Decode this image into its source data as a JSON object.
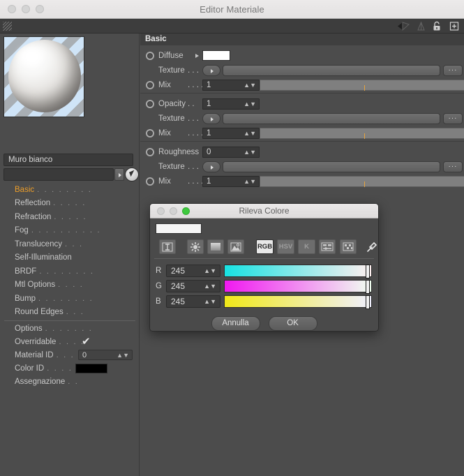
{
  "window": {
    "title": "Editor Materiale",
    "traffic_lights": [
      "close",
      "minimize",
      "zoom"
    ],
    "toolbar_icons": [
      "camera-icon",
      "light-icon",
      "lock-icon",
      "add-icon"
    ]
  },
  "material": {
    "preview_name": "material-preview-sphere",
    "name_value": "Muro bianco",
    "search_value": "",
    "picker_icon": "arrow-picker-icon"
  },
  "channels": [
    {
      "label": "Basic",
      "dots": ". . . . . . . ."
    },
    {
      "label": "Reflection",
      "dots": ". . . . ."
    },
    {
      "label": "Refraction",
      "dots": ". . . . ."
    },
    {
      "label": "Fog",
      "dots": ". . . . . . . . . ."
    },
    {
      "label": "Translucency",
      "dots": ". . ."
    },
    {
      "label": "Self-Illumination",
      "dots": ""
    },
    {
      "label": "BRDF",
      "dots": ". . . . . . . ."
    },
    {
      "label": "Mtl Options",
      "dots": ". . . ."
    },
    {
      "label": "Bump",
      "dots": ". . . . . . . ."
    },
    {
      "label": "Round Edges",
      "dots": ". . ."
    }
  ],
  "options": {
    "options_label": "Options",
    "options_dots": ". . . . . . .",
    "overridable_label": "Overridable",
    "overridable_dots": ". . . .",
    "overridable_checked": "✔",
    "material_id_label": "Material ID",
    "material_id_dots": ". . . . .",
    "material_id_value": "0",
    "color_id_label": "Color ID",
    "color_id_dots": ". . . . . . .",
    "color_id_value": "#000000",
    "assignment_label": "Assegnazione",
    "assignment_dots": ". ."
  },
  "basic_panel": {
    "section_title": "Basic",
    "rows": [
      {
        "type": "color",
        "label": "Diffuse",
        "dots": "",
        "value": "#ffffff"
      },
      {
        "type": "texture",
        "label": "Texture",
        "dots": ". . .",
        "value": "",
        "more": "···"
      },
      {
        "type": "slider",
        "label": "Mix",
        "dots": ". . . . . .",
        "value": "1",
        "tick_pct": 50
      },
      {
        "type": "number",
        "label": "Opacity",
        "dots": ". .",
        "value": "1"
      },
      {
        "type": "texture",
        "label": "Texture",
        "dots": ". . .",
        "value": "",
        "more": "···"
      },
      {
        "type": "slider",
        "label": "Mix",
        "dots": ". . . . . .",
        "value": "1",
        "tick_pct": 50
      },
      {
        "type": "number",
        "label": "Roughness",
        "dots": "",
        "value": "0"
      },
      {
        "type": "texture",
        "label": "Texture",
        "dots": ". . .",
        "value": "",
        "more": "···"
      },
      {
        "type": "slider",
        "label": "Mix",
        "dots": ". . . . . .",
        "value": "1",
        "tick_pct": 50
      }
    ]
  },
  "color_dialog": {
    "title": "Rileva Colore",
    "traffic_lights": [
      "close",
      "minimize",
      "zoom-active"
    ],
    "preview_color": "#f5f5f5",
    "tools": [
      {
        "name": "swatches-icon",
        "type": "icon",
        "label": ""
      },
      {
        "name": "color-wheel-icon",
        "type": "icon",
        "label": ""
      },
      {
        "name": "gradient-icon",
        "type": "icon",
        "label": ""
      },
      {
        "name": "image-icon",
        "type": "icon",
        "label": ""
      },
      {
        "name": "mode-rgb",
        "type": "mode",
        "label": "RGB",
        "active": true
      },
      {
        "name": "mode-hsv",
        "type": "mode",
        "label": "HSV",
        "active": false
      },
      {
        "name": "mode-k",
        "type": "mode",
        "label": "K",
        "active": false
      },
      {
        "name": "sliders-icon",
        "type": "icon",
        "label": ""
      },
      {
        "name": "mixer-icon",
        "type": "icon",
        "label": ""
      },
      {
        "name": "eyedropper-icon",
        "type": "icon",
        "label": ""
      }
    ],
    "channels": [
      {
        "label": "R",
        "value": "245",
        "from": "#17e2e2",
        "to": "#fff0f0",
        "knob_pct": 96.1
      },
      {
        "label": "G",
        "value": "245",
        "from": "#f018f0",
        "to": "#f0fff0",
        "knob_pct": 96.1
      },
      {
        "label": "B",
        "value": "245",
        "from": "#f0e818",
        "to": "#f0f0ff",
        "knob_pct": 96.1
      }
    ],
    "cancel_label": "Annulla",
    "ok_label": "OK"
  },
  "colors": {
    "accent": "#eb9d2a",
    "panel_bg": "#4c4c4c",
    "section_bg": "#3f3f3f",
    "dialog_bg": "#4a4a4a"
  }
}
